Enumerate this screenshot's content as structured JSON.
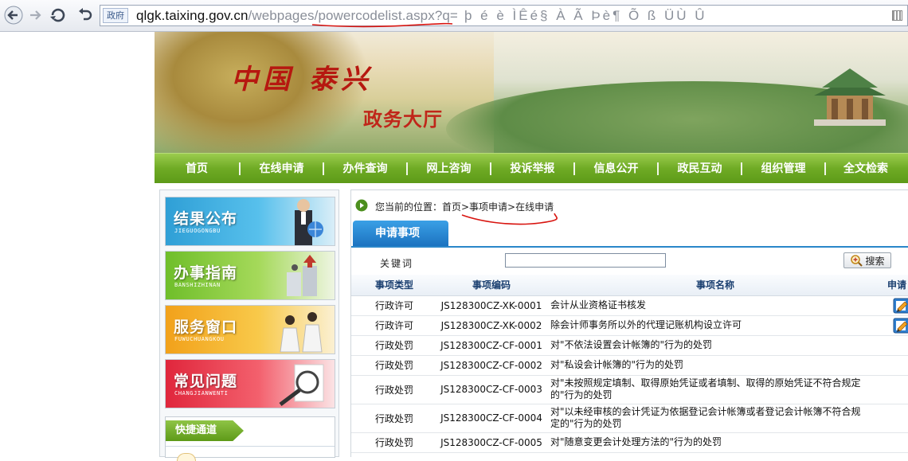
{
  "browser": {
    "identity_label": "政府",
    "url_host": "qlgk.taixing.gov.cn",
    "url_path": "/webpages/powercodelist.aspx?q=",
    "url_junk": "þ é è ÌÊé§ À Ã Þè¶  Õ ß ÜÙ Û"
  },
  "banner": {
    "logo_text": "中国 泰兴",
    "hall_text": "政务大厅"
  },
  "nav": {
    "items": [
      "首页",
      "在线申请",
      "办件查询",
      "网上咨询",
      "投诉举报",
      "信息公开",
      "政民互动",
      "组织管理",
      "全文检索"
    ]
  },
  "sidebar": {
    "cards": [
      {
        "title": "结果公布",
        "sub": "JIEGUOGONGBU"
      },
      {
        "title": "办事指南",
        "sub": "BANSHIZHINAN"
      },
      {
        "title": "服务窗口",
        "sub": "FUWUCHUANGKOU"
      },
      {
        "title": "常见问题",
        "sub": "CHANGJIANWENTI"
      }
    ],
    "quick_label": "快捷通道"
  },
  "content": {
    "breadcrumb": "您当前的位置：首页>事项申请>在线申请",
    "tab_label": "申请事项",
    "keyword_label": "关键词",
    "keyword_value": "",
    "search_label": "搜索",
    "table": {
      "headers": [
        "事项类型",
        "事项编码",
        "事项名称",
        "申请"
      ],
      "rows": [
        {
          "type": "行政许可",
          "code": "JS128300CZ-XK-0001",
          "name": "会计从业资格证书核发",
          "apply": true
        },
        {
          "type": "行政许可",
          "code": "JS128300CZ-XK-0002",
          "name": "除会计师事务所以外的代理记账机构设立许可",
          "apply": true
        },
        {
          "type": "行政处罚",
          "code": "JS128300CZ-CF-0001",
          "name": "对\"不依法设置会计帐簿的\"行为的处罚",
          "apply": false
        },
        {
          "type": "行政处罚",
          "code": "JS128300CZ-CF-0002",
          "name": "对\"私设会计帐簿的\"行为的处罚",
          "apply": false
        },
        {
          "type": "行政处罚",
          "code": "JS128300CZ-CF-0003",
          "name": "对\"未按照规定填制、取得原始凭证或者填制、取得的原始凭证不符合规定的\"行为的处罚",
          "apply": false
        },
        {
          "type": "行政处罚",
          "code": "JS128300CZ-CF-0004",
          "name": "对\"以未经审核的会计凭证为依据登记会计帐簿或者登记会计帐簿不符合规定的\"行为的处罚",
          "apply": false
        },
        {
          "type": "行政处罚",
          "code": "JS128300CZ-CF-0005",
          "name": "对\"随意变更会计处理方法的\"行为的处罚",
          "apply": false
        }
      ]
    }
  },
  "colors": {
    "nav_green": "#6fab25",
    "tab_blue": "#1c73c0",
    "annotation_red": "#d8140f"
  }
}
